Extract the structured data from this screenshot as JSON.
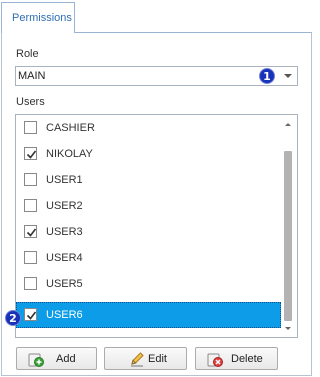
{
  "tab": {
    "label": "Permissions"
  },
  "role": {
    "label": "Role",
    "value": "MAIN"
  },
  "users": {
    "label": "Users",
    "items": [
      {
        "name": "CASHIER",
        "checked": false,
        "selected": false
      },
      {
        "name": "NIKOLAY",
        "checked": true,
        "selected": false
      },
      {
        "name": "USER1",
        "checked": false,
        "selected": false
      },
      {
        "name": "USER2",
        "checked": false,
        "selected": false
      },
      {
        "name": "USER3",
        "checked": true,
        "selected": false
      },
      {
        "name": "USER4",
        "checked": false,
        "selected": false
      },
      {
        "name": "USER5",
        "checked": false,
        "selected": false
      },
      {
        "name": "USER6",
        "checked": true,
        "selected": true
      }
    ]
  },
  "markers": {
    "role": "1",
    "selected_user": "2"
  },
  "buttons": {
    "add": "Add",
    "edit": "Edit",
    "delete": "Delete"
  },
  "icons": {
    "add": "add-icon",
    "edit": "edit-icon",
    "delete": "delete-icon",
    "dropdown": "chevron-down-icon"
  },
  "colors": {
    "selection": "#0d9de8",
    "marker": "#1833b8",
    "tab_text": "#2f6fb5"
  }
}
